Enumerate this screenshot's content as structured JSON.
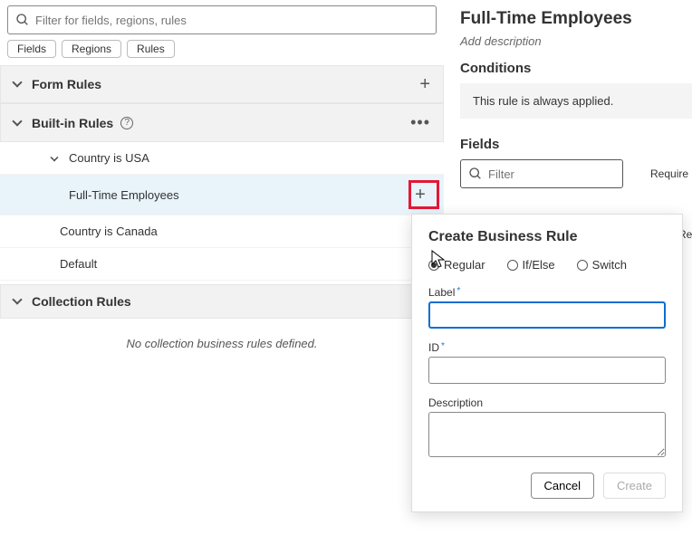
{
  "search": {
    "placeholder": "Filter for fields, regions, rules"
  },
  "chips": {
    "fields": "Fields",
    "regions": "Regions",
    "rules": "Rules"
  },
  "sections": {
    "form_rules": "Form Rules",
    "builtin_rules": "Built-in Rules",
    "collection_rules": "Collection Rules"
  },
  "tree": {
    "country_usa": "Country is USA",
    "full_time": "Full-Time Employees",
    "country_canada": "Country is Canada",
    "default": "Default"
  },
  "empty_collection": "No collection business rules defined.",
  "right": {
    "title": "Full-Time Employees",
    "add_desc": "Add description",
    "conditions": "Conditions",
    "always_applied": "This rule is always applied.",
    "fields": "Fields",
    "filter_placeholder": "Filter",
    "col_required": "Require",
    "col_required2": "Re"
  },
  "dialog": {
    "title": "Create Business Rule",
    "radio_regular": "Regular",
    "radio_ifelse": "If/Else",
    "radio_switch": "Switch",
    "label": "Label",
    "id": "ID",
    "description": "Description",
    "cancel": "Cancel",
    "create": "Create"
  }
}
